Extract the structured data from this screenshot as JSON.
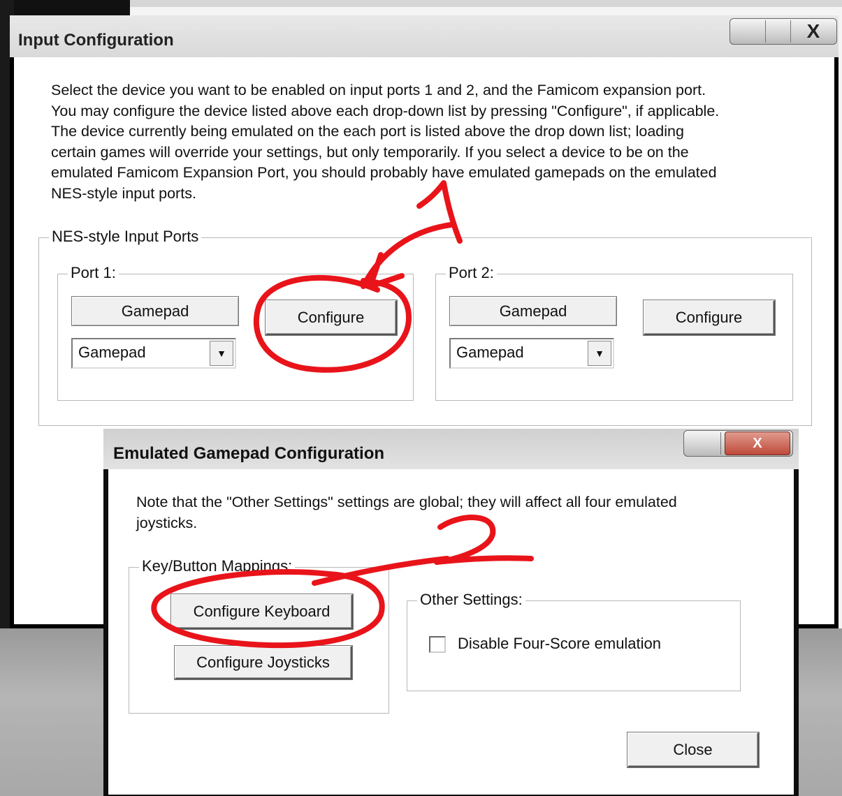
{
  "main_window": {
    "title": "Input Configuration",
    "close_glyph": "X",
    "description_lines": [
      "Select the device you want to be enabled on input ports 1 and 2, and the Famicom expansion port.",
      "You may configure the device listed above each drop-down list by pressing \"Configure\", if applicable.",
      "The device currently being emulated on the each port is listed above the drop down list; loading",
      "certain games will override your settings, but only temporarily.  If you select a device to be on the",
      "emulated Famicom Expansion Port, you should probably have emulated gamepads on the emulated",
      "NES-style input ports."
    ],
    "nes_ports_group_label": "NES-style Input Ports",
    "port1": {
      "label": "Port 1:",
      "current_device": "Gamepad",
      "configure_label": "Configure",
      "selected_device": "Gamepad"
    },
    "port2": {
      "label": "Port 2:",
      "current_device": "Gamepad",
      "configure_label": "Configure",
      "selected_device": "Gamepad"
    }
  },
  "gamepad_window": {
    "title": "Emulated Gamepad Configuration",
    "close_glyph": "X",
    "note_lines": [
      "Note that the \"Other Settings\" settings are global; they will affect all four emulated",
      "joysticks."
    ],
    "mappings_group_label": "Key/Button Mappings:",
    "configure_keyboard_label": "Configure Keyboard",
    "configure_joysticks_label": "Configure Joysticks",
    "other_settings_group_label": "Other Settings:",
    "disable_four_score_label": "Disable Four-Score emulation",
    "disable_four_score_checked": false,
    "close_label": "Close"
  },
  "annotations": {
    "color": "#e8141a",
    "marks": [
      "1",
      "2"
    ]
  },
  "colors": {
    "window_frame": "#0e0e0e",
    "button_face": "#f0f0f0",
    "close_button_red": "#c04a3a"
  }
}
